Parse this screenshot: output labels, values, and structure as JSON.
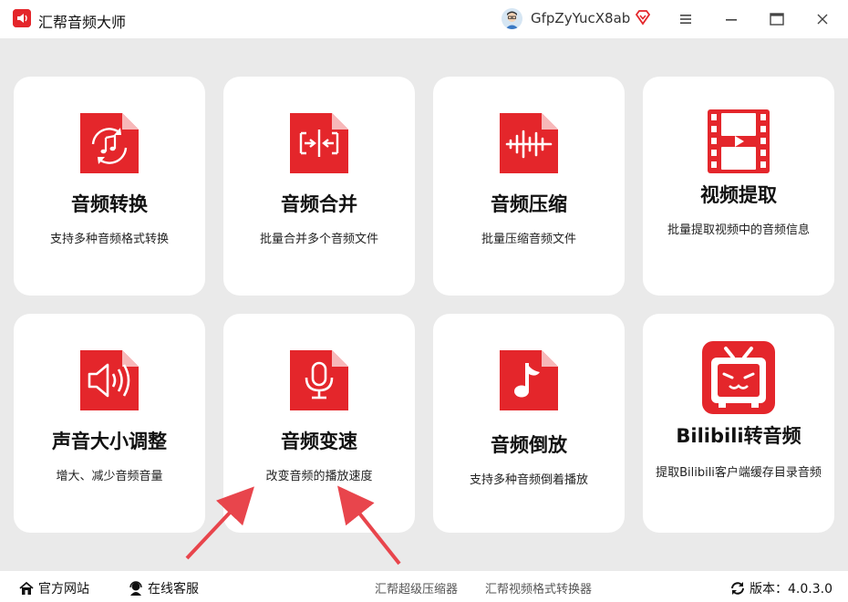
{
  "app": {
    "title": "汇帮音频大师",
    "username": "GfpZyYucX8ab",
    "accent_color": "#e4262b"
  },
  "window_controls": [
    "menu-icon",
    "minimize-icon",
    "maximize-icon",
    "close-icon"
  ],
  "cards": [
    {
      "title": "音频转换",
      "desc": "支持多种音频格式转换",
      "icon": "audio-convert-icon"
    },
    {
      "title": "音频合并",
      "desc": "批量合并多个音频文件",
      "icon": "audio-merge-icon"
    },
    {
      "title": "音频压缩",
      "desc": "批量压缩音频文件",
      "icon": "audio-compress-icon"
    },
    {
      "title": "视频提取",
      "desc": "批量提取视频中的音频信息",
      "icon": "video-film-icon"
    },
    {
      "title": "声音大小调整",
      "desc": "增大、减少音频音量",
      "icon": "speaker-icon"
    },
    {
      "title": "音频变速",
      "desc": "改变音频的播放速度",
      "icon": "microphone-icon"
    },
    {
      "title": "音频倒放",
      "desc": "支持多种音频倒着播放",
      "icon": "music-note-icon"
    },
    {
      "title": "Bilibili转音频",
      "desc": "提取Bilibili客户端缓存目录音频",
      "icon": "bilibili-tv-icon"
    }
  ],
  "footer": {
    "official_site": "官方网站",
    "online_service": "在线客服",
    "link1": "汇帮超级压缩器",
    "link2": "汇帮视频格式转换器",
    "version": "版本：4.0.3.0"
  }
}
